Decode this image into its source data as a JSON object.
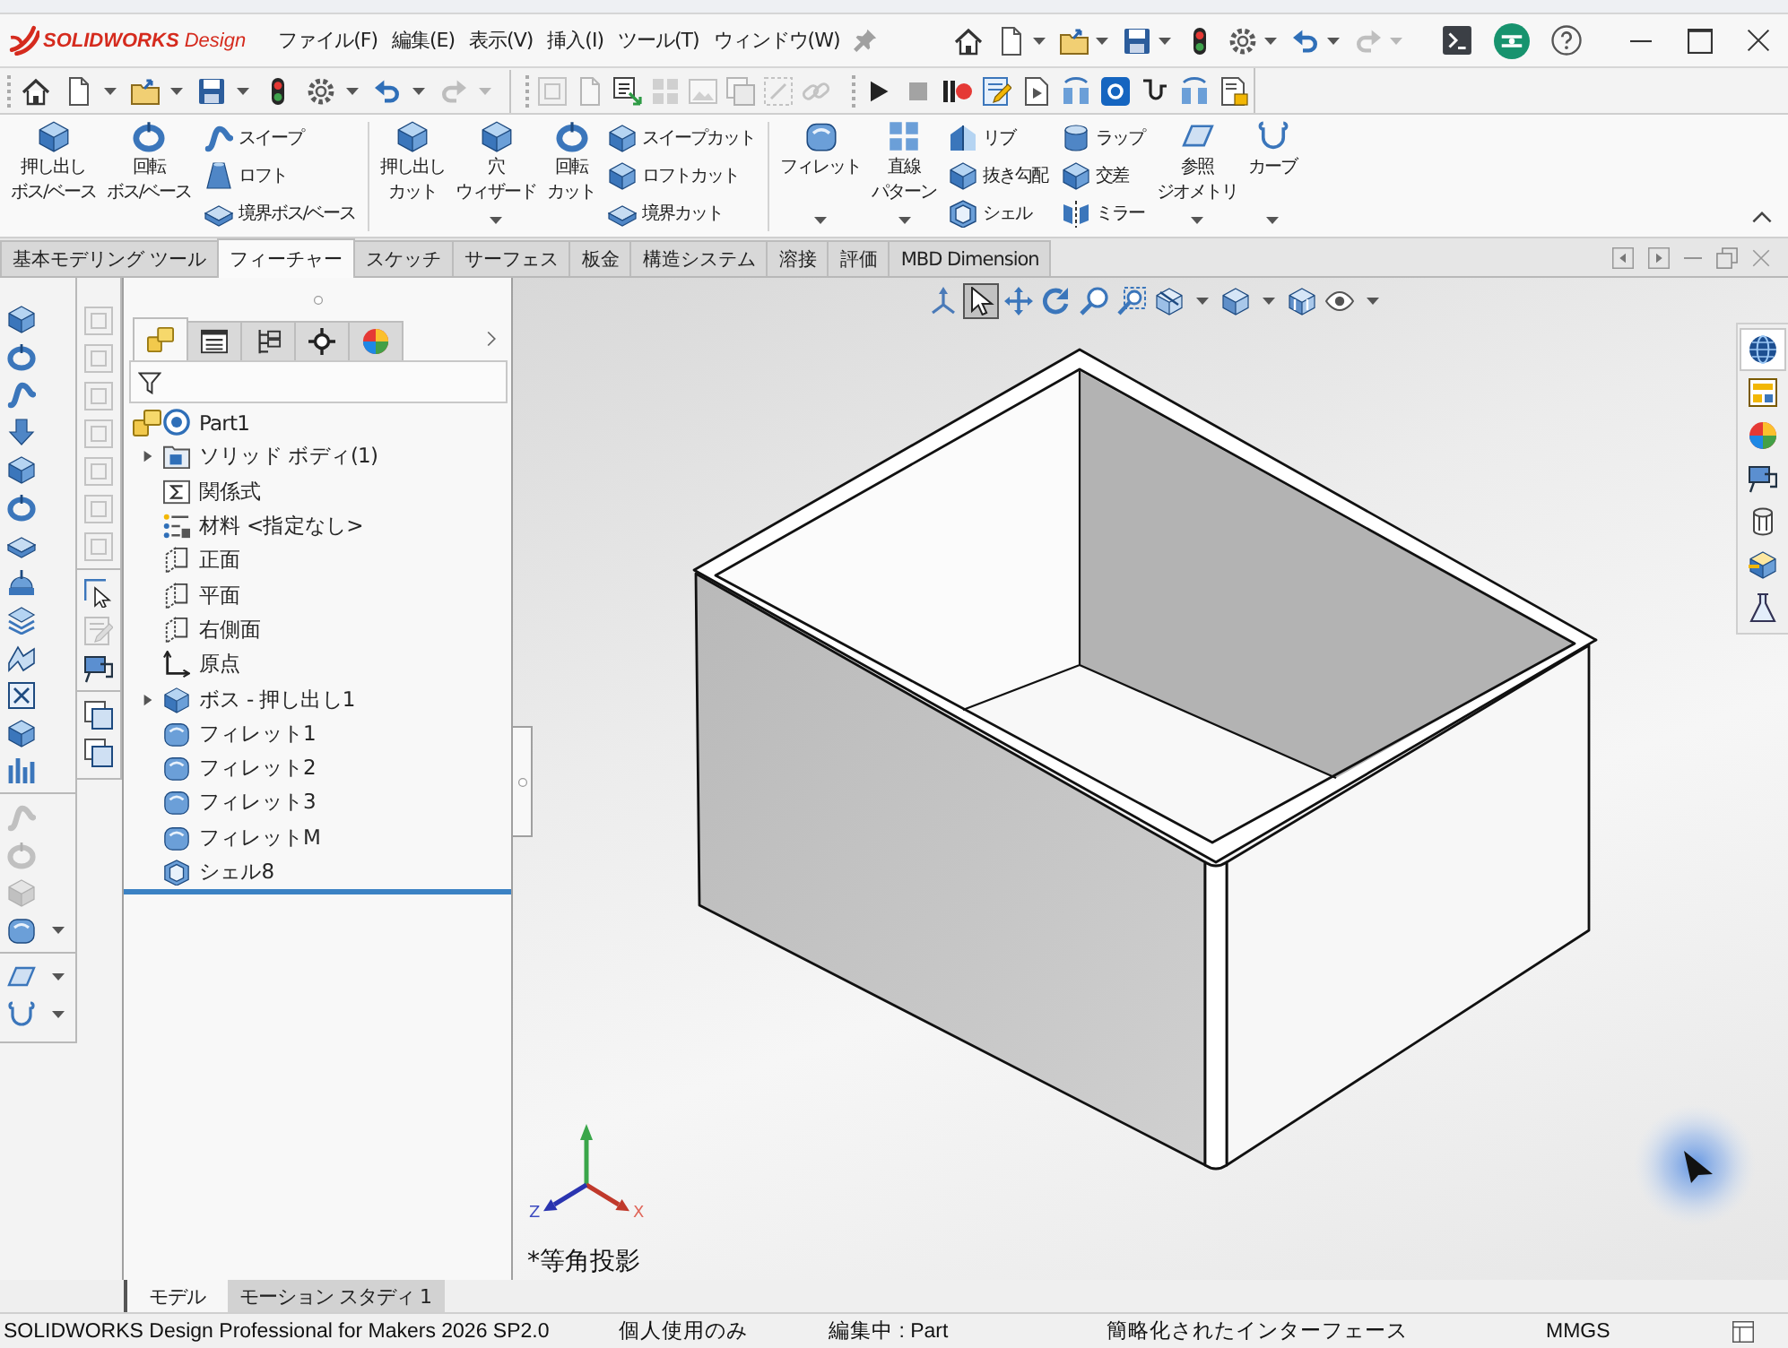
{
  "window": {
    "logo": "**SOLIDWORKS** Design",
    "menu": [
      "ファイル(F)",
      "編集(E)",
      "表示(V)",
      "挿入(I)",
      "ツール(T)",
      "ウィンドウ(W)"
    ],
    "quick_access": [
      {
        "disabled": false
      },
      {
        "disabled": false
      },
      {
        "disabled": false
      },
      {
        "disabled": false
      },
      {
        "disabled": false
      },
      {
        "disabled": false
      },
      {
        "disabled": false
      },
      {
        "disabled": true
      }
    ]
  },
  "toolbar": {
    "quick_access": [
      {
        "disabled": false
      },
      {
        "disabled": false
      },
      {
        "disabled": false
      },
      {
        "disabled": false
      },
      {
        "disabled": false
      },
      {
        "disabled": false
      },
      {
        "disabled": false
      },
      {
        "disabled": true
      }
    ],
    "tools": [
      {
        "disabled": true
      },
      {
        "disabled": true
      },
      {
        "disabled": false
      },
      {
        "disabled": true
      },
      {
        "disabled": true
      },
      {
        "disabled": true
      },
      {
        "disabled": true
      },
      {
        "disabled": true
      }
    ],
    "macro": [
      {
        "disabled": false
      },
      {
        "disabled": false
      },
      {
        "disabled": false
      },
      {
        "disabled": false
      },
      {
        "disabled": false
      },
      {
        "disabled": false
      },
      {
        "disabled": false
      },
      {
        "disabled": false
      },
      {
        "disabled": false
      },
      {
        "disabled": false
      }
    ]
  },
  "ribbon": {
    "sections": [
      [
        {
          "kind": "large",
          "label": "押し出しボス/ベース",
          "dropdown": false
        },
        {
          "kind": "large",
          "label": "回転ボス/ベース",
          "dropdown": false
        },
        {
          "kind": "stack",
          "items": [
            "スイープ",
            "ロフト",
            "境界ボス/ベース"
          ]
        }
      ],
      [
        {
          "kind": "large",
          "label": "押し出しカット",
          "dropdown": false
        },
        {
          "kind": "large",
          "label": "穴ウィザード",
          "dropdown": true
        },
        {
          "kind": "large",
          "label": "回転カット",
          "dropdown": false
        },
        {
          "kind": "stack",
          "items": [
            "スイープカット",
            "ロフトカット",
            "境界カット"
          ]
        }
      ],
      [
        {
          "kind": "large",
          "label": "フィレット",
          "dropdown": true
        },
        {
          "kind": "large",
          "label": "直線パターン",
          "dropdown": true
        },
        {
          "kind": "stack",
          "items": [
            "リブ",
            "抜き勾配",
            "シェル"
          ]
        },
        {
          "kind": "stack",
          "items": [
            "ラップ",
            "交差",
            "ミラー"
          ]
        },
        {
          "kind": "large",
          "label": "参照ジオメトリ",
          "dropdown": true
        },
        {
          "kind": "large",
          "label": "カーブ",
          "dropdown": true
        }
      ]
    ],
    "tabs": [
      {
        "label": "基本モデリング ツール",
        "selected": false
      },
      {
        "label": "フィーチャー",
        "selected": true
      },
      {
        "label": "スケッチ",
        "selected": false
      },
      {
        "label": "サーフェス",
        "selected": false
      },
      {
        "label": "板金",
        "selected": false
      },
      {
        "label": "構造システム",
        "selected": false
      },
      {
        "label": "溶接",
        "selected": false
      },
      {
        "label": "評価",
        "selected": false
      },
      {
        "label": "MBD Dimension",
        "selected": false
      }
    ]
  },
  "left_toolbar": [
    [
      {
        "disabled": false
      },
      {
        "disabled": false
      },
      {
        "disabled": false
      },
      {
        "disabled": false
      },
      {
        "disabled": false
      },
      {
        "disabled": false
      },
      {
        "disabled": false
      },
      {
        "disabled": false
      },
      {
        "disabled": false
      },
      {
        "disabled": false
      },
      {
        "disabled": false
      },
      {
        "disabled": false
      },
      {
        "disabled": false
      }
    ],
    [
      {
        "disabled": true
      },
      {
        "disabled": true
      },
      {
        "disabled": true
      },
      {
        "disabled": false
      }
    ],
    [
      {
        "disabled": false
      },
      {
        "disabled": false
      }
    ]
  ],
  "secondary_toolbar": [
    [
      {
        "disabled": true
      },
      {
        "disabled": true
      },
      {
        "disabled": true
      },
      {
        "disabled": true
      },
      {
        "disabled": true
      },
      {
        "disabled": true
      },
      {
        "disabled": true
      }
    ],
    [
      {
        "disabled": false
      },
      {
        "disabled": true
      },
      {
        "disabled": false
      }
    ],
    [
      {
        "disabled": false
      },
      {
        "disabled": false
      }
    ]
  ],
  "feature_manager": {
    "tabs": [
      {
        "selected": true
      },
      {
        "selected": false
      },
      {
        "selected": false
      },
      {
        "selected": false
      },
      {
        "selected": false
      }
    ],
    "tree": [
      {
        "label": "Part1",
        "kind": "part",
        "children": [
          {
            "label": "ソリッド ボディ(1)",
            "kind": "bodies",
            "expanded": false
          },
          {
            "label": "関係式",
            "kind": "equations"
          },
          {
            "label": "材料 <指定なし>",
            "kind": "material"
          },
          {
            "label": "正面",
            "kind": "plane"
          },
          {
            "label": "平面",
            "kind": "plane"
          },
          {
            "label": "右側面",
            "kind": "plane"
          },
          {
            "label": "原点",
            "kind": "origin"
          },
          {
            "label": "ボス - 押し出し1",
            "kind": "extrude",
            "expanded": false
          },
          {
            "label": "フィレット1",
            "kind": "fillet"
          },
          {
            "label": "フィレット2",
            "kind": "fillet"
          },
          {
            "label": "フィレット3",
            "kind": "fillet"
          },
          {
            "label": "フィレットM",
            "kind": "fillet"
          },
          {
            "label": "シェル8",
            "kind": "shell"
          }
        ]
      }
    ]
  },
  "viewport": {
    "heads_up_toolbar": [
      {
        "selected": false
      },
      {
        "selected": true
      },
      {
        "selected": false
      },
      {
        "selected": false
      },
      {
        "selected": false
      },
      {
        "selected": false
      },
      {
        "selected": false
      },
      {
        "selected": false
      },
      {
        "selected": false
      },
      {
        "selected": false
      }
    ],
    "task_pane": [
      {
        "selected": true
      },
      {
        "selected": false
      },
      {
        "selected": false
      },
      {
        "selected": false
      },
      {
        "selected": false
      },
      {
        "selected": false
      },
      {
        "selected": false
      }
    ],
    "triad": {
      "x": "X",
      "z": "Z"
    },
    "view_name": "*等角投影"
  },
  "model_tabs": [
    {
      "label": "モデル",
      "selected": true
    },
    {
      "label": "モーション スタディ 1",
      "selected": false
    }
  ],
  "status_bar": {
    "product": "SOLIDWORKS Design Professional for Makers 2026 SP2.0",
    "license": "個人使用のみ",
    "editing": "編集中 : Part",
    "interface": "簡略化されたインターフェース",
    "units": "MMGS"
  }
}
